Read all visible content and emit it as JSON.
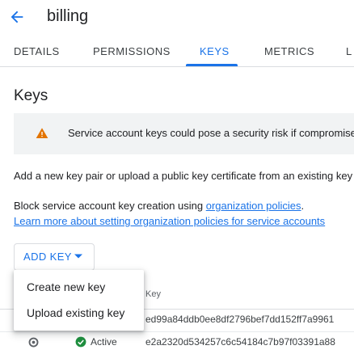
{
  "header": {
    "title": "billing"
  },
  "tabs": [
    {
      "label": "DETAILS"
    },
    {
      "label": "PERMISSIONS"
    },
    {
      "label": "KEYS"
    },
    {
      "label": "METRICS"
    },
    {
      "label": "L"
    }
  ],
  "active_tab": "KEYS",
  "section": {
    "title": "Keys"
  },
  "warning": {
    "text": "Service account keys could pose a security risk if compromise"
  },
  "info": {
    "line1": "Add a new key pair or upload a public key certificate from an existing key",
    "line2_prefix": "Block service account key creation using ",
    "line2_link": "organization policies",
    "line2_suffix": ".",
    "line3_link": "Learn more about setting organization policies for service accounts"
  },
  "add_key": {
    "label": "ADD KEY"
  },
  "menu": {
    "items": [
      {
        "label": "Create new key"
      },
      {
        "label": "Upload existing key"
      }
    ]
  },
  "table": {
    "header_key": "Key",
    "rows": [
      {
        "status": "",
        "key_id": "ed99a84ddb0ee8df2796bef7dd152ff7a9961"
      },
      {
        "status": "Active",
        "key_id": "e2a2320d534257c6c54184c7b97f03391a88"
      }
    ]
  },
  "colors": {
    "accent": "#1a73e8",
    "warning": "#e37400",
    "active": "#1e8e3e"
  }
}
